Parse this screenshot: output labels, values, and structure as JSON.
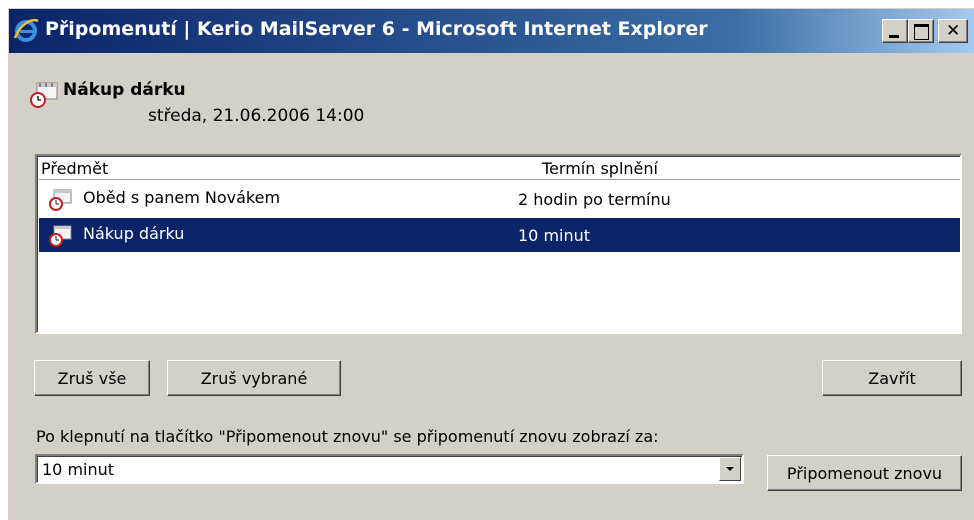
{
  "window": {
    "title": "Připomenutí | Kerio MailServer 6 - Microsoft Internet Explorer"
  },
  "event": {
    "icon": "calendar-reminder-icon",
    "title": "Nákup dárku",
    "date": "středa, 21.06.2006 14:00"
  },
  "list": {
    "columns": [
      "Předmět",
      "Termín splnění"
    ],
    "rows": [
      {
        "subject": "Oběd s panem Novákem",
        "due": "2 hodin po termínu",
        "selected": false
      },
      {
        "subject": "Nákup dárku",
        "due": "10 minut",
        "selected": true
      }
    ]
  },
  "buttons": {
    "clear_all": "Zruš vše",
    "clear_selected": "Zruš vybrané",
    "close": "Zavřít",
    "remind_again": "Připomenout znovu"
  },
  "snooze": {
    "hint": "Po klepnutí na tlačítko \"Připomenout znovu\" se připomenutí znovu zobrazí za:",
    "selected": "10 minut"
  },
  "colors": {
    "selection": "#0a246a",
    "window_face": "#d4d0c8"
  }
}
